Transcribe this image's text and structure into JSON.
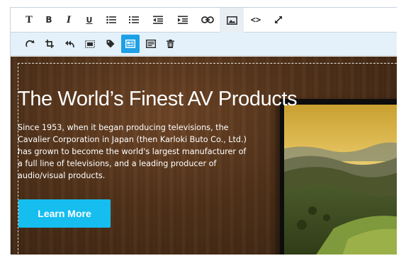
{
  "toolbar_main": {
    "buttons": [
      {
        "name": "text-style",
        "icon": "text-format-icon",
        "glyph": "T"
      },
      {
        "name": "bold",
        "icon": "bold-icon",
        "glyph": "B"
      },
      {
        "name": "italic",
        "icon": "italic-icon",
        "glyph": "I"
      },
      {
        "name": "underline",
        "icon": "underline-icon",
        "glyph": "U"
      },
      {
        "name": "bulleted-list",
        "icon": "bulleted-list-icon"
      },
      {
        "name": "numbered-list",
        "icon": "numbered-list-icon"
      },
      {
        "name": "outdent",
        "icon": "outdent-icon"
      },
      {
        "name": "indent",
        "icon": "indent-icon"
      },
      {
        "name": "link",
        "icon": "link-icon"
      },
      {
        "name": "image",
        "icon": "image-icon",
        "active": true
      },
      {
        "name": "source-code",
        "icon": "code-icon",
        "glyph": "<>"
      },
      {
        "name": "fullscreen",
        "icon": "expand-icon"
      }
    ]
  },
  "toolbar_image": {
    "buttons": [
      {
        "name": "rotate",
        "icon": "rotate-icon"
      },
      {
        "name": "crop",
        "icon": "crop-icon"
      },
      {
        "name": "revert",
        "icon": "revert-icon"
      },
      {
        "name": "fit-frame",
        "icon": "fit-frame-icon"
      },
      {
        "name": "tag",
        "icon": "tag-icon"
      },
      {
        "name": "image-settings",
        "icon": "image-settings-icon",
        "active": true
      },
      {
        "name": "image-caption",
        "icon": "image-caption-icon"
      },
      {
        "name": "delete",
        "icon": "trash-icon"
      }
    ]
  },
  "hero": {
    "title": "The World’s Finest AV Products",
    "body_lines": [
      "Since 1953, when it began producing televisions, the",
      "Cavalier Corporation in Japan (then Karloki Buto Co., Ltd.)",
      "has grown to become the world's largest manufacturer of",
      "a full line of televisions, and a leading producer of",
      "audio/visual products."
    ],
    "button_label": "Learn More"
  },
  "colors": {
    "accent": "#1ea0e6",
    "button": "#16bef0",
    "toolbar_bg": "#e4f1fb",
    "hero_wood": "#51321a"
  }
}
